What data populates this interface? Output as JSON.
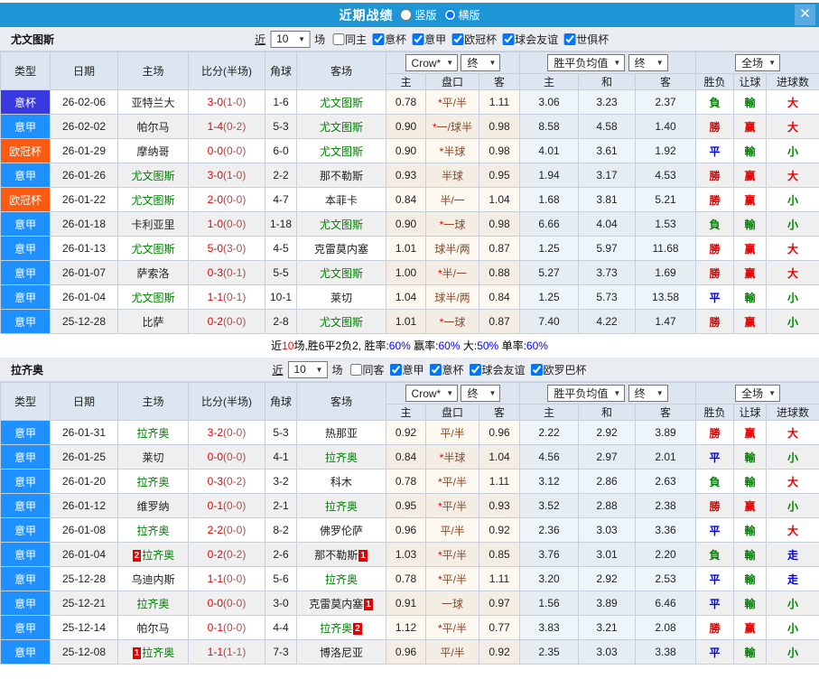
{
  "title": {
    "text": "近期战绩",
    "vertical_label": "竖版",
    "vertical_checked": false,
    "horizontal_label": "横版",
    "horizontal_checked": true
  },
  "icons": {
    "chevron_down": "▼",
    "close": "✕"
  },
  "filters_common": {
    "near": "近",
    "games": "场"
  },
  "table_header": {
    "type": "类型",
    "date": "日期",
    "home": "主场",
    "score": "比分(半场)",
    "corner": "角球",
    "away": "客场",
    "odds_source": "Crow*",
    "final_a": "终",
    "avg_label": "胜平负均值",
    "final_b": "终",
    "scope": "全场",
    "sub": {
      "h": "主",
      "hcap": "盘口",
      "a": "客",
      "avg_h": "主",
      "avg_d": "和",
      "avg_a": "客",
      "wdl": "胜负",
      "handicap": "让球",
      "goals": "进球数"
    }
  },
  "colors": {
    "titlebar": "#1e96d5",
    "badge": {
      "意杯": "#3939e0",
      "意甲": "#1e90ff",
      "欧冠杯": "#fd5a11"
    },
    "result": {
      "勝": "#e60000",
      "負": "#008000",
      "平": "#0000e6",
      "赢": "#e60000",
      "輸": "#008000",
      "大": "#e60000",
      "小": "#008000",
      "走": "#0000e6"
    }
  },
  "sections": [
    {
      "team": "尤文图斯",
      "count": "10",
      "same_label": "同主",
      "same_checked": false,
      "leagues": [
        {
          "label": "意杯",
          "checked": true
        },
        {
          "label": "意甲",
          "checked": true
        },
        {
          "label": "欧冠杯",
          "checked": true
        },
        {
          "label": "球会友谊",
          "checked": true
        },
        {
          "label": "世俱杯",
          "checked": true
        }
      ],
      "rows": [
        {
          "type": "意杯",
          "date": "26-02-06",
          "home": "亚特兰大",
          "home_subject": false,
          "home_card": "",
          "home_card_side": "",
          "score": "3-0",
          "half": "(1-0)",
          "corner": "1-6",
          "away": "尤文图斯",
          "away_subject": true,
          "away_card": "",
          "away_card_side": "",
          "o1": "0.78",
          "star": true,
          "hcap": "平/半",
          "o2": "1.11",
          "avg_h": "3.06",
          "avg_d": "3.23",
          "avg_a": "2.37",
          "wdl": "負",
          "handicap_result": "輸",
          "goals": "大"
        },
        {
          "type": "意甲",
          "date": "26-02-02",
          "home": "帕尔马",
          "home_subject": false,
          "home_card": "",
          "home_card_side": "",
          "score": "1-4",
          "half": "(0-2)",
          "corner": "5-3",
          "away": "尤文图斯",
          "away_subject": true,
          "away_card": "",
          "away_card_side": "",
          "o1": "0.90",
          "star": true,
          "hcap": "一/球半",
          "o2": "0.98",
          "avg_h": "8.58",
          "avg_d": "4.58",
          "avg_a": "1.40",
          "wdl": "勝",
          "handicap_result": "赢",
          "goals": "大"
        },
        {
          "type": "欧冠杯",
          "date": "26-01-29",
          "home": "摩纳哥",
          "home_subject": false,
          "home_card": "",
          "home_card_side": "",
          "score": "0-0",
          "half": "(0-0)",
          "corner": "6-0",
          "away": "尤文图斯",
          "away_subject": true,
          "away_card": "",
          "away_card_side": "",
          "o1": "0.90",
          "star": true,
          "hcap": "半球",
          "o2": "0.98",
          "avg_h": "4.01",
          "avg_d": "3.61",
          "avg_a": "1.92",
          "wdl": "平",
          "handicap_result": "輸",
          "goals": "小"
        },
        {
          "type": "意甲",
          "date": "26-01-26",
          "home": "尤文图斯",
          "home_subject": true,
          "home_card": "",
          "home_card_side": "",
          "score": "3-0",
          "half": "(1-0)",
          "corner": "2-2",
          "away": "那不勒斯",
          "away_subject": false,
          "away_card": "",
          "away_card_side": "",
          "o1": "0.93",
          "star": false,
          "hcap": "半球",
          "o2": "0.95",
          "avg_h": "1.94",
          "avg_d": "3.17",
          "avg_a": "4.53",
          "wdl": "勝",
          "handicap_result": "赢",
          "goals": "大"
        },
        {
          "type": "欧冠杯",
          "date": "26-01-22",
          "home": "尤文图斯",
          "home_subject": true,
          "home_card": "",
          "home_card_side": "",
          "score": "2-0",
          "half": "(0-0)",
          "corner": "4-7",
          "away": "本菲卡",
          "away_subject": false,
          "away_card": "",
          "away_card_side": "",
          "o1": "0.84",
          "star": false,
          "hcap": "半/一",
          "o2": "1.04",
          "avg_h": "1.68",
          "avg_d": "3.81",
          "avg_a": "5.21",
          "wdl": "勝",
          "handicap_result": "赢",
          "goals": "小"
        },
        {
          "type": "意甲",
          "date": "26-01-18",
          "home": "卡利亚里",
          "home_subject": false,
          "home_card": "",
          "home_card_side": "",
          "score": "1-0",
          "half": "(0-0)",
          "corner": "1-18",
          "away": "尤文图斯",
          "away_subject": true,
          "away_card": "",
          "away_card_side": "",
          "o1": "0.90",
          "star": true,
          "hcap": "一球",
          "o2": "0.98",
          "avg_h": "6.66",
          "avg_d": "4.04",
          "avg_a": "1.53",
          "wdl": "負",
          "handicap_result": "輸",
          "goals": "小"
        },
        {
          "type": "意甲",
          "date": "26-01-13",
          "home": "尤文图斯",
          "home_subject": true,
          "home_card": "",
          "home_card_side": "",
          "score": "5-0",
          "half": "(3-0)",
          "corner": "4-5",
          "away": "克雷莫内塞",
          "away_subject": false,
          "away_card": "",
          "away_card_side": "",
          "o1": "1.01",
          "star": false,
          "hcap": "球半/两",
          "o2": "0.87",
          "avg_h": "1.25",
          "avg_d": "5.97",
          "avg_a": "11.68",
          "wdl": "勝",
          "handicap_result": "赢",
          "goals": "大"
        },
        {
          "type": "意甲",
          "date": "26-01-07",
          "home": "萨索洛",
          "home_subject": false,
          "home_card": "",
          "home_card_side": "",
          "score": "0-3",
          "half": "(0-1)",
          "corner": "5-5",
          "away": "尤文图斯",
          "away_subject": true,
          "away_card": "",
          "away_card_side": "",
          "o1": "1.00",
          "star": true,
          "hcap": "半/一",
          "o2": "0.88",
          "avg_h": "5.27",
          "avg_d": "3.73",
          "avg_a": "1.69",
          "wdl": "勝",
          "handicap_result": "赢",
          "goals": "大"
        },
        {
          "type": "意甲",
          "date": "26-01-04",
          "home": "尤文图斯",
          "home_subject": true,
          "home_card": "",
          "home_card_side": "",
          "score": "1-1",
          "half": "(0-1)",
          "corner": "10-1",
          "away": "莱切",
          "away_subject": false,
          "away_card": "",
          "away_card_side": "",
          "o1": "1.04",
          "star": false,
          "hcap": "球半/两",
          "o2": "0.84",
          "avg_h": "1.25",
          "avg_d": "5.73",
          "avg_a": "13.58",
          "wdl": "平",
          "handicap_result": "輸",
          "goals": "小"
        },
        {
          "type": "意甲",
          "date": "25-12-28",
          "home": "比萨",
          "home_subject": false,
          "home_card": "",
          "home_card_side": "",
          "score": "0-2",
          "half": "(0-0)",
          "corner": "2-8",
          "away": "尤文图斯",
          "away_subject": true,
          "away_card": "",
          "away_card_side": "",
          "o1": "1.01",
          "star": true,
          "hcap": "一球",
          "o2": "0.87",
          "avg_h": "7.40",
          "avg_d": "4.22",
          "avg_a": "1.47",
          "wdl": "勝",
          "handicap_result": "赢",
          "goals": "小"
        }
      ],
      "summary_segments": [
        {
          "text": "近",
          "color": "#000000"
        },
        {
          "text": "10",
          "color": "#ff0000"
        },
        {
          "text": "场,胜6平2负2, 胜率:",
          "color": "#000000"
        },
        {
          "text": "60%",
          "color": "#0000ff"
        },
        {
          "text": " 赢率:",
          "color": "#000000"
        },
        {
          "text": "60%",
          "color": "#0000ff"
        },
        {
          "text": " 大:",
          "color": "#000000"
        },
        {
          "text": "50%",
          "color": "#0000ff"
        },
        {
          "text": " 单率:",
          "color": "#000000"
        },
        {
          "text": "60%",
          "color": "#0000ff"
        }
      ]
    },
    {
      "team": "拉齐奥",
      "count": "10",
      "same_label": "同客",
      "same_checked": false,
      "leagues": [
        {
          "label": "意甲",
          "checked": true
        },
        {
          "label": "意杯",
          "checked": true
        },
        {
          "label": "球会友谊",
          "checked": true
        },
        {
          "label": "欧罗巴杯",
          "checked": true
        }
      ],
      "rows": [
        {
          "type": "意甲",
          "date": "26-01-31",
          "home": "拉齐奥",
          "home_subject": true,
          "home_card": "",
          "home_card_side": "",
          "score": "3-2",
          "half": "(0-0)",
          "corner": "5-3",
          "away": "热那亚",
          "away_subject": false,
          "away_card": "",
          "away_card_side": "",
          "o1": "0.92",
          "star": false,
          "hcap": "平/半",
          "o2": "0.96",
          "avg_h": "2.22",
          "avg_d": "2.92",
          "avg_a": "3.89",
          "wdl": "勝",
          "handicap_result": "赢",
          "goals": "大"
        },
        {
          "type": "意甲",
          "date": "26-01-25",
          "home": "莱切",
          "home_subject": false,
          "home_card": "",
          "home_card_side": "",
          "score": "0-0",
          "half": "(0-0)",
          "corner": "4-1",
          "away": "拉齐奥",
          "away_subject": true,
          "away_card": "",
          "away_card_side": "",
          "o1": "0.84",
          "star": true,
          "hcap": "半球",
          "o2": "1.04",
          "avg_h": "4.56",
          "avg_d": "2.97",
          "avg_a": "2.01",
          "wdl": "平",
          "handicap_result": "輸",
          "goals": "小"
        },
        {
          "type": "意甲",
          "date": "26-01-20",
          "home": "拉齐奥",
          "home_subject": true,
          "home_card": "",
          "home_card_side": "",
          "score": "0-3",
          "half": "(0-2)",
          "corner": "3-2",
          "away": "科木",
          "away_subject": false,
          "away_card": "",
          "away_card_side": "",
          "o1": "0.78",
          "star": true,
          "hcap": "平/半",
          "o2": "1.11",
          "avg_h": "3.12",
          "avg_d": "2.86",
          "avg_a": "2.63",
          "wdl": "負",
          "handicap_result": "輸",
          "goals": "大"
        },
        {
          "type": "意甲",
          "date": "26-01-12",
          "home": "维罗纳",
          "home_subject": false,
          "home_card": "",
          "home_card_side": "",
          "score": "0-1",
          "half": "(0-0)",
          "corner": "2-1",
          "away": "拉齐奥",
          "away_subject": true,
          "away_card": "",
          "away_card_side": "",
          "o1": "0.95",
          "star": true,
          "hcap": "平/半",
          "o2": "0.93",
          "avg_h": "3.52",
          "avg_d": "2.88",
          "avg_a": "2.38",
          "wdl": "勝",
          "handicap_result": "赢",
          "goals": "小"
        },
        {
          "type": "意甲",
          "date": "26-01-08",
          "home": "拉齐奥",
          "home_subject": true,
          "home_card": "",
          "home_card_side": "",
          "score": "2-2",
          "half": "(0-0)",
          "corner": "8-2",
          "away": "佛罗伦萨",
          "away_subject": false,
          "away_card": "",
          "away_card_side": "",
          "o1": "0.96",
          "star": false,
          "hcap": "平/半",
          "o2": "0.92",
          "avg_h": "2.36",
          "avg_d": "3.03",
          "avg_a": "3.36",
          "wdl": "平",
          "handicap_result": "輸",
          "goals": "大"
        },
        {
          "type": "意甲",
          "date": "26-01-04",
          "home": "拉齐奥",
          "home_subject": true,
          "home_card": "2",
          "home_card_side": "left",
          "score": "0-2",
          "half": "(0-2)",
          "corner": "2-6",
          "away": "那不勒斯",
          "away_subject": false,
          "away_card": "1",
          "away_card_side": "right",
          "o1": "1.03",
          "star": true,
          "hcap": "平/半",
          "o2": "0.85",
          "avg_h": "3.76",
          "avg_d": "3.01",
          "avg_a": "2.20",
          "wdl": "負",
          "handicap_result": "輸",
          "goals": "走"
        },
        {
          "type": "意甲",
          "date": "25-12-28",
          "home": "乌迪内斯",
          "home_subject": false,
          "home_card": "",
          "home_card_side": "",
          "score": "1-1",
          "half": "(0-0)",
          "corner": "5-6",
          "away": "拉齐奥",
          "away_subject": true,
          "away_card": "",
          "away_card_side": "",
          "o1": "0.78",
          "star": true,
          "hcap": "平/半",
          "o2": "1.11",
          "avg_h": "3.20",
          "avg_d": "2.92",
          "avg_a": "2.53",
          "wdl": "平",
          "handicap_result": "輸",
          "goals": "走"
        },
        {
          "type": "意甲",
          "date": "25-12-21",
          "home": "拉齐奥",
          "home_subject": true,
          "home_card": "",
          "home_card_side": "",
          "score": "0-0",
          "half": "(0-0)",
          "corner": "3-0",
          "away": "克雷莫内塞",
          "away_subject": false,
          "away_card": "1",
          "away_card_side": "right",
          "o1": "0.91",
          "star": false,
          "hcap": "一球",
          "o2": "0.97",
          "avg_h": "1.56",
          "avg_d": "3.89",
          "avg_a": "6.46",
          "wdl": "平",
          "handicap_result": "輸",
          "goals": "小"
        },
        {
          "type": "意甲",
          "date": "25-12-14",
          "home": "帕尔马",
          "home_subject": false,
          "home_card": "",
          "home_card_side": "",
          "score": "0-1",
          "half": "(0-0)",
          "corner": "4-4",
          "away": "拉齐奥",
          "away_subject": true,
          "away_card": "2",
          "away_card_side": "right",
          "o1": "1.12",
          "star": true,
          "hcap": "平/半",
          "o2": "0.77",
          "avg_h": "3.83",
          "avg_d": "3.21",
          "avg_a": "2.08",
          "wdl": "勝",
          "handicap_result": "赢",
          "goals": "小"
        },
        {
          "type": "意甲",
          "date": "25-12-08",
          "home": "拉齐奥",
          "home_subject": true,
          "home_card": "1",
          "home_card_side": "left",
          "score": "1-1",
          "half": "(1-1)",
          "corner": "7-3",
          "away": "博洛尼亚",
          "away_subject": false,
          "away_card": "",
          "away_card_side": "",
          "o1": "0.96",
          "star": false,
          "hcap": "平/半",
          "o2": "0.92",
          "avg_h": "2.35",
          "avg_d": "3.03",
          "avg_a": "3.38",
          "wdl": "平",
          "handicap_result": "輸",
          "goals": "小"
        }
      ]
    }
  ]
}
